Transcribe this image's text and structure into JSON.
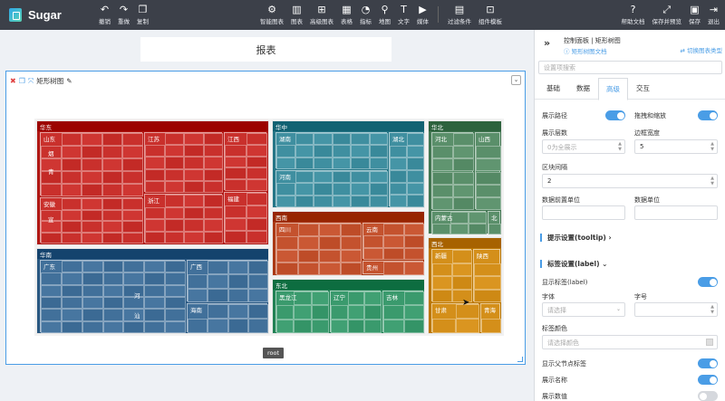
{
  "app": {
    "name": "Sugar"
  },
  "toolbar": {
    "left": [
      {
        "label": "撤销",
        "icon": "↶"
      },
      {
        "label": "重做",
        "icon": "↷"
      },
      {
        "label": "复制",
        "icon": "❐"
      }
    ],
    "center": [
      {
        "label": "智能图表",
        "icon": "⚙"
      },
      {
        "label": "图表",
        "icon": "▥"
      },
      {
        "label": "高级图表",
        "icon": "⊞"
      },
      {
        "label": "表格",
        "icon": "▦"
      },
      {
        "label": "指标",
        "icon": "◔"
      },
      {
        "label": "地图",
        "icon": "⚲"
      },
      {
        "label": "文字",
        "icon": "T"
      },
      {
        "label": "媒体",
        "icon": "▶"
      },
      {
        "label": "过滤条件",
        "icon": "▤"
      },
      {
        "label": "组件模板",
        "icon": "⊡"
      }
    ],
    "right": [
      {
        "label": "帮助文档",
        "icon": "?"
      },
      {
        "label": "保存并预览",
        "icon": "⤢"
      },
      {
        "label": "保存",
        "icon": "▣"
      },
      {
        "label": "退出",
        "icon": "⇥"
      }
    ]
  },
  "canvas": {
    "report_title": "报表",
    "widget": {
      "title": "矩形树图",
      "root_label": "root"
    }
  },
  "treemap": {
    "regions": [
      {
        "name": "华东",
        "color": "#c9302c",
        "provinces": [
          "山东",
          "江苏",
          "江西",
          "浙江",
          "安徽",
          "福建"
        ],
        "sub_labels": [
          "烟",
          "青",
          "宣"
        ]
      },
      {
        "name": "华中",
        "color": "#3f8fa0",
        "provinces": [
          "湖南",
          "湖北",
          "河南"
        ]
      },
      {
        "name": "华北",
        "color": "#5a8f6a",
        "provinces": [
          "河北",
          "山西",
          "内蒙古",
          "北"
        ]
      },
      {
        "name": "西南",
        "color": "#c4522e",
        "provinces": [
          "四川",
          "云南",
          "贵州"
        ]
      },
      {
        "name": "华南",
        "color": "#41709a",
        "provinces": [
          "广东",
          "广西",
          "海南"
        ],
        "sub_labels": [
          "河",
          "汕"
        ]
      },
      {
        "name": "东北",
        "color": "#3a9a6d",
        "provinces": [
          "黑龙江",
          "辽宁",
          "吉林"
        ]
      },
      {
        "name": "西北",
        "color": "#d48f1a",
        "provinces": [
          "新疆",
          "陕西",
          "甘肃",
          "青海"
        ]
      }
    ]
  },
  "panel": {
    "breadcrumb": "控制面板 | 矩形树图",
    "doc_link": "矩形树图文档",
    "switch_link": "切换图表类型",
    "search_placeholder": "设置项搜索",
    "tabs": [
      "基础",
      "数据",
      "高级",
      "交互"
    ],
    "active_tab": 2,
    "fields": {
      "show_path": "展示路径",
      "drag_zoom": "拖拽和缩放",
      "levels": "展示层数",
      "levels_value": "0为全展示",
      "border_width": "边框宽度",
      "border_width_value": "5",
      "block_gap": "区块间隔",
      "block_gap_value": "2",
      "prefix_unit": "数据前置单位",
      "data_unit": "数据单位",
      "tooltip_section": "提示设置(tooltip)",
      "label_section": "标签设置(label)",
      "show_label": "显示标签(label)",
      "font": "字体",
      "font_placeholder": "请选择",
      "font_size": "字号",
      "label_color": "标签颜色",
      "label_color_placeholder": "请选择颜色",
      "show_parent_label": "显示父节点标签",
      "show_name": "展示名称",
      "show_value": "展示数值"
    }
  }
}
